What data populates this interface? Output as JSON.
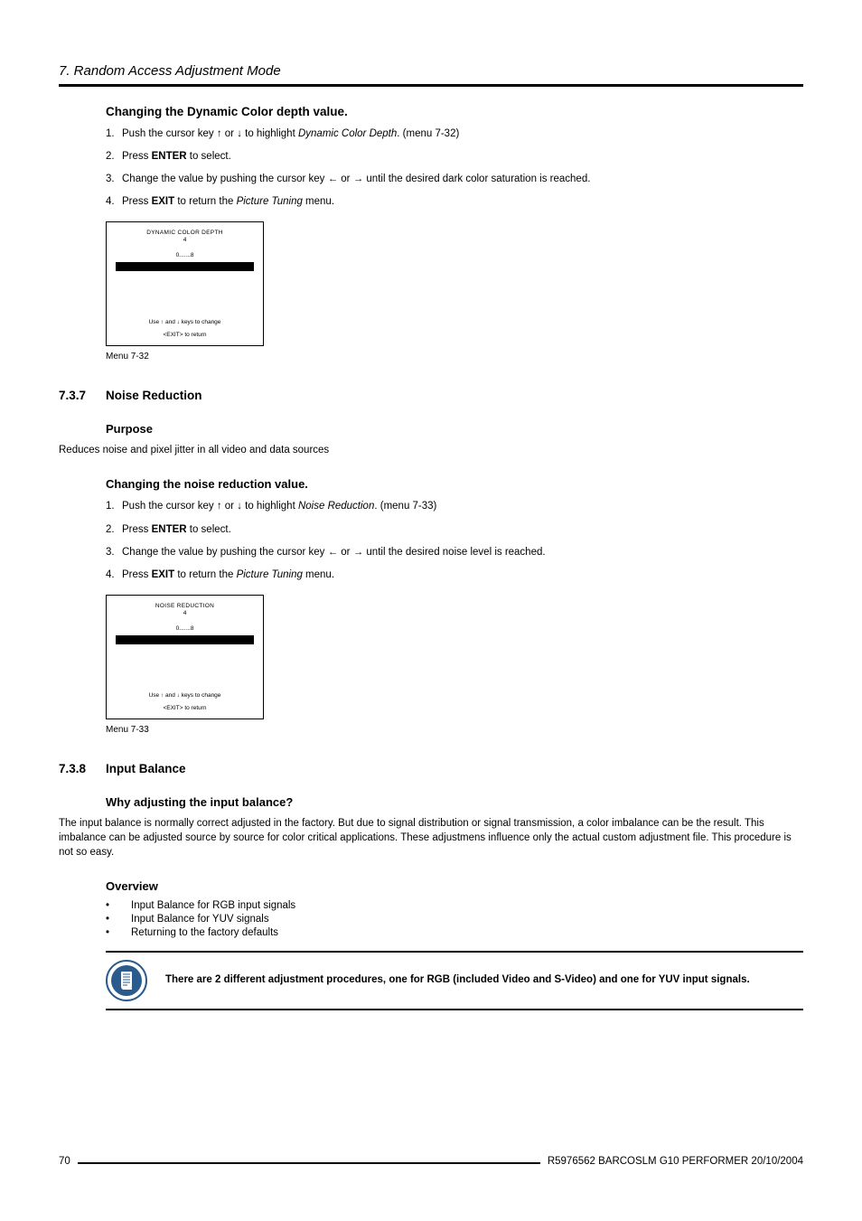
{
  "chapter": "7. Random Access Adjustment Mode",
  "sec1": {
    "heading": "Changing the Dynamic Color depth value.",
    "steps": {
      "s1a": "Push the cursor key ↑ or ↓ to highlight ",
      "s1b": "Dynamic Color Depth",
      "s1c": ". (menu 7-32)",
      "s2a": "Press ",
      "s2b": "ENTER",
      "s2c": " to select.",
      "s3": "Change the value by pushing the cursor key ← or → until the desired dark color saturation is reached.",
      "s4a": "Press ",
      "s4b": "EXIT",
      "s4c": " to return the ",
      "s4d": "Picture Tuning",
      "s4e": " menu."
    },
    "menu": {
      "title": "DYNAMIC COLOR DEPTH",
      "subtitle": "4",
      "range": "0.......8",
      "keys": "Use ↑ and ↓ keys to change",
      "exit": "<EXIT> to return",
      "caption": "Menu 7-32"
    }
  },
  "sec2": {
    "num": "7.3.7",
    "title": "Noise Reduction",
    "purpose_h": "Purpose",
    "purpose_t": "Reduces noise and pixel jitter in all video and data sources",
    "changing_h": "Changing the noise reduction value.",
    "steps": {
      "s1a": "Push the cursor key ↑ or ↓ to highlight ",
      "s1b": "Noise Reduction",
      "s1c": ". (menu 7-33)",
      "s2a": "Press ",
      "s2b": "ENTER",
      "s2c": " to select.",
      "s3": "Change the value by pushing the cursor key ← or → until the desired noise level is reached.",
      "s4a": "Press ",
      "s4b": "EXIT",
      "s4c": " to return the ",
      "s4d": "Picture Tuning",
      "s4e": " menu."
    },
    "menu": {
      "title": "NOISE REDUCTION",
      "subtitle": "4",
      "range": "0.......8",
      "keys": "Use ↑ and ↓ keys to change",
      "exit": "<EXIT> to return",
      "caption": "Menu 7-33"
    }
  },
  "sec3": {
    "num": "7.3.8",
    "title": "Input Balance",
    "why_h": "Why adjusting the input balance?",
    "why_t": "The input balance is normally correct adjusted in the factory. But due to signal distribution or signal transmission, a color imbalance can be the result. This imbalance can be adjusted source by source for color critical applications. These adjustmens influence only the actual custom adjustment file. This procedure is not so easy.",
    "ov_h": "Overview",
    "ov_items": {
      "i1": "Input Balance for RGB input signals",
      "i2": "Input Balance for YUV signals",
      "i3": "Returning to the factory defaults"
    },
    "note": "There are 2 different adjustment procedures, one for RGB (included Video and S-Video) and one for YUV input signals."
  },
  "footer": {
    "page": "70",
    "doc": "R5976562  BARCOSLM G10 PERFORMER  20/10/2004"
  }
}
